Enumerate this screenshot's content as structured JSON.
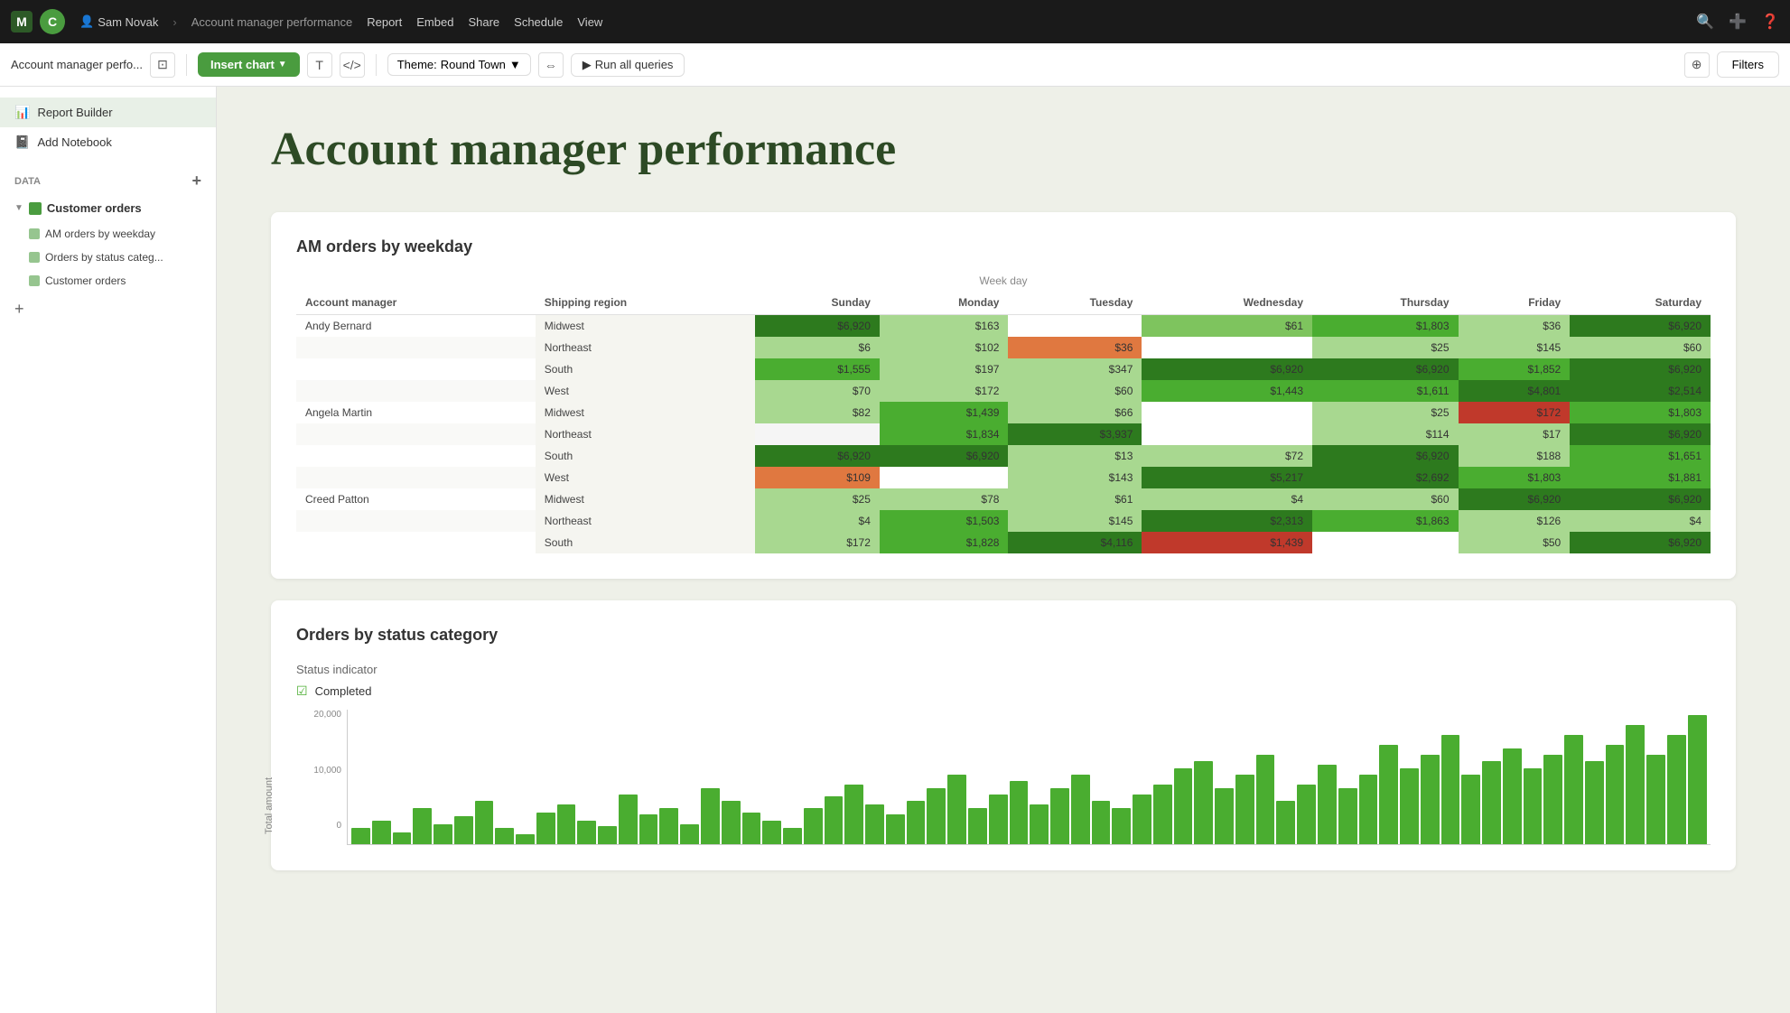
{
  "topbar": {
    "workspace": "M",
    "logo": "C",
    "user": "Sam Novak",
    "report_prefix": "Report -",
    "embed": "Embed",
    "title": "Account manager performance",
    "nav": {
      "report": "Report",
      "embed": "Embed",
      "share": "Share",
      "schedule": "Schedule",
      "view": "View"
    }
  },
  "toolbar": {
    "page_title": "Account manager perfo...",
    "insert_chart": "Insert chart",
    "text_icon": "T",
    "code_icon": "</>",
    "theme_label": "Theme:",
    "theme_value": "Round Town",
    "run_queries": "Run all queries",
    "filters": "Filters"
  },
  "sidebar": {
    "report_builder": "Report Builder",
    "add_notebook": "Add Notebook",
    "data_section": "DATA",
    "datasource": "Customer orders",
    "sub_items": [
      "AM orders by weekday",
      "Orders by status categ...",
      "Customer orders"
    ]
  },
  "page": {
    "title": "Account manager performance",
    "chart1_title": "AM orders by weekday",
    "week_day_label": "Week day",
    "table_headers": [
      "Account manager",
      "Shipping region",
      "Sunday",
      "Monday",
      "Tuesday",
      "Wednesday",
      "Thursday",
      "Friday",
      "Saturday"
    ],
    "rows": [
      {
        "manager": "Andy Bernard",
        "regions": [
          {
            "region": "Midwest",
            "sun": "$6,920",
            "mon": "$163",
            "tue": "",
            "wed": "$61",
            "thu": "$1,803",
            "fri": "$36",
            "sat": "$6,920",
            "sun_c": "c-green-dark",
            "mon_c": "c-green-pale",
            "tue_c": "c-white",
            "wed_c": "c-green-light",
            "thu_c": "c-green-med",
            "fri_c": "c-green-pale",
            "sat_c": "c-green-dark"
          },
          {
            "region": "Northeast",
            "sun": "$6",
            "mon": "$102",
            "tue": "$36",
            "wed": "",
            "thu": "$25",
            "fri": "$145",
            "sat": "$60",
            "sun_c": "c-green-pale",
            "mon_c": "c-green-pale",
            "tue_c": "c-orange",
            "wed_c": "c-white",
            "thu_c": "c-green-pale",
            "fri_c": "c-green-pale",
            "sat_c": "c-green-pale"
          },
          {
            "region": "South",
            "sun": "$1,555",
            "mon": "$197",
            "tue": "$347",
            "wed": "$6,920",
            "thu": "$6,920",
            "fri": "$1,852",
            "sat": "$6,920",
            "sun_c": "c-green-med",
            "mon_c": "c-green-pale",
            "tue_c": "c-green-pale",
            "wed_c": "c-green-dark",
            "thu_c": "c-green-dark",
            "fri_c": "c-green-med",
            "sat_c": "c-green-dark"
          },
          {
            "region": "West",
            "sun": "$70",
            "mon": "$172",
            "tue": "$60",
            "wed": "$1,443",
            "thu": "$1,611",
            "fri": "$4,801",
            "sat": "$2,514",
            "sun_c": "c-green-pale",
            "mon_c": "c-green-pale",
            "tue_c": "c-green-pale",
            "wed_c": "c-green-med",
            "thu_c": "c-green-med",
            "fri_c": "c-green-dark",
            "sat_c": "c-green-dark"
          }
        ]
      },
      {
        "manager": "Angela Martin",
        "regions": [
          {
            "region": "Midwest",
            "sun": "$82",
            "mon": "$1,439",
            "tue": "$66",
            "wed": "",
            "thu": "$25",
            "fri": "$172",
            "sat": "$1,803",
            "sun_c": "c-green-pale",
            "mon_c": "c-green-med",
            "tue_c": "c-green-pale",
            "wed_c": "c-white",
            "thu_c": "c-green-pale",
            "fri_c": "c-red",
            "sat_c": "c-green-med"
          },
          {
            "region": "Northeast",
            "sun": "",
            "mon": "$1,834",
            "tue": "$3,937",
            "wed": "",
            "thu": "$114",
            "fri": "$17",
            "sat": "$6,920",
            "sun_c": "c-gray-light",
            "mon_c": "c-green-med",
            "tue_c": "c-green-dark",
            "wed_c": "c-white",
            "thu_c": "c-green-pale",
            "fri_c": "c-green-pale",
            "sat_c": "c-green-dark"
          },
          {
            "region": "South",
            "sun": "$6,920",
            "mon": "$6,920",
            "tue": "$13",
            "wed": "$72",
            "thu": "$6,920",
            "fri": "$188",
            "sat": "$1,651",
            "sun_c": "c-green-dark",
            "mon_c": "c-green-dark",
            "tue_c": "c-green-pale",
            "wed_c": "c-green-pale",
            "thu_c": "c-green-dark",
            "fri_c": "c-green-pale",
            "sat_c": "c-green-med"
          },
          {
            "region": "West",
            "sun": "$109",
            "mon": "",
            "tue": "$143",
            "wed": "$5,217",
            "thu": "$2,692",
            "fri": "$1,803",
            "sat": "$1,881",
            "sun_c": "c-orange",
            "mon_c": "c-white",
            "tue_c": "c-green-pale",
            "wed_c": "c-green-dark",
            "thu_c": "c-green-dark",
            "fri_c": "c-green-med",
            "sat_c": "c-green-med"
          }
        ]
      },
      {
        "manager": "Creed Patton",
        "regions": [
          {
            "region": "Midwest",
            "sun": "$25",
            "mon": "$78",
            "tue": "$61",
            "wed": "$4",
            "thu": "$60",
            "fri": "$6,920",
            "sat": "$6,920",
            "sun_c": "c-green-pale",
            "mon_c": "c-green-pale",
            "tue_c": "c-green-pale",
            "wed_c": "c-green-pale",
            "thu_c": "c-green-pale",
            "fri_c": "c-green-dark",
            "sat_c": "c-green-dark"
          },
          {
            "region": "Northeast",
            "sun": "$4",
            "mon": "$1,503",
            "tue": "$145",
            "wed": "$2,313",
            "thu": "$1,863",
            "fri": "$126",
            "sat": "$4",
            "sun_c": "c-green-pale",
            "mon_c": "c-green-med",
            "tue_c": "c-green-pale",
            "wed_c": "c-green-dark",
            "thu_c": "c-green-med",
            "fri_c": "c-green-pale",
            "sat_c": "c-green-pale"
          },
          {
            "region": "South",
            "sun": "$172",
            "mon": "$1,828",
            "tue": "$4,116",
            "wed": "$1,439",
            "thu": "",
            "fri": "$50",
            "sat": "$6,920",
            "sun_c": "c-green-pale",
            "mon_c": "c-green-med",
            "tue_c": "c-green-dark",
            "wed_c": "c-red",
            "thu_c": "c-white",
            "fri_c": "c-green-pale",
            "sat_c": "c-green-dark"
          }
        ]
      }
    ],
    "chart2_title": "Orders by status category",
    "status_label": "Status indicator",
    "status_completed": "Completed",
    "y_axis_labels": [
      "20,000",
      "10,000",
      "0"
    ],
    "total_amount_label": "Total amount"
  }
}
